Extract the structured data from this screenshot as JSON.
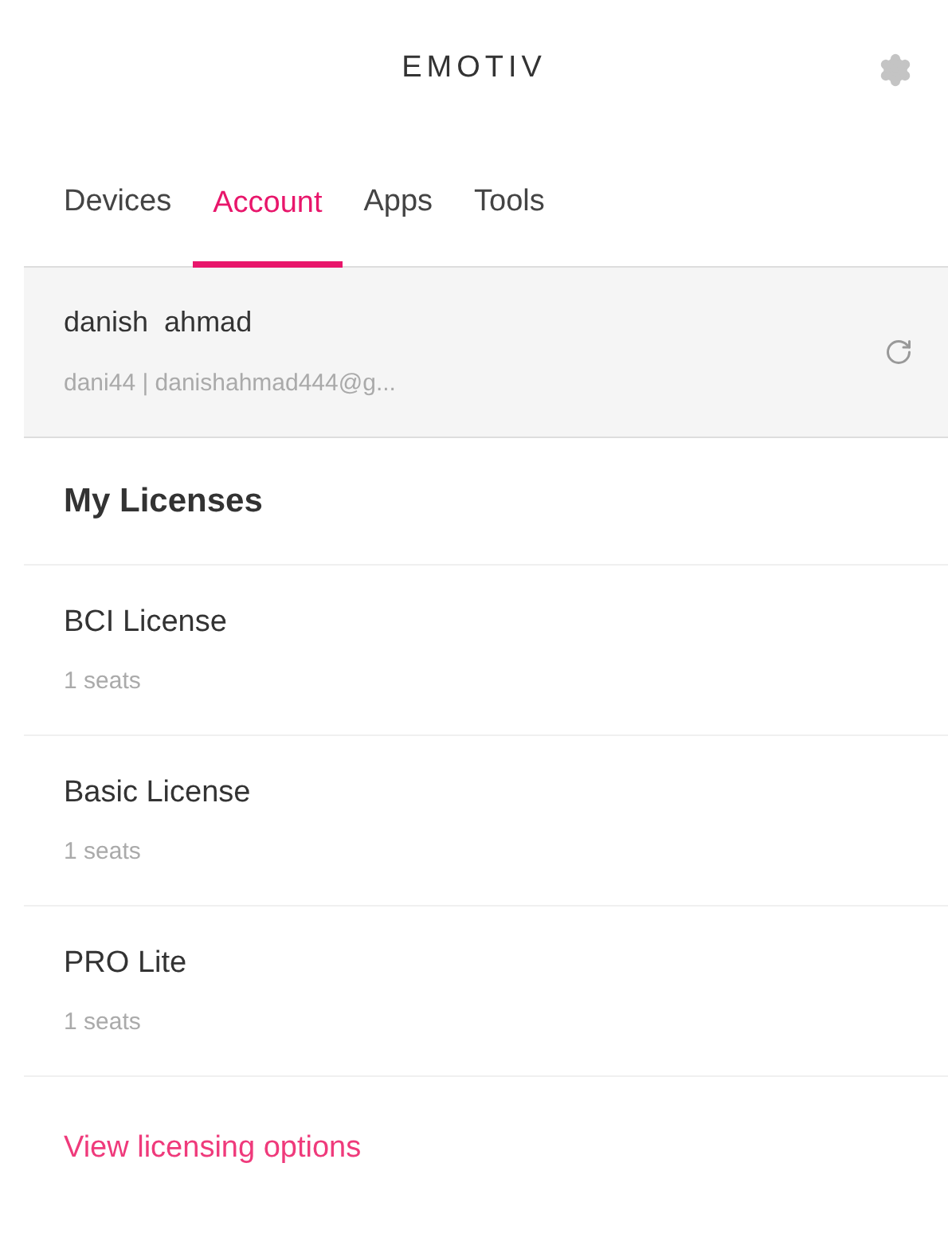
{
  "header": {
    "logo": "EMOTIV"
  },
  "tabs": [
    {
      "label": "Devices",
      "selected": false
    },
    {
      "label": "Account",
      "selected": true
    },
    {
      "label": "Apps",
      "selected": false
    },
    {
      "label": "Tools",
      "selected": false
    }
  ],
  "account": {
    "name": "danish  ahmad",
    "details": "dani44 | danishahmad444@g..."
  },
  "licenses": {
    "title": "My Licenses",
    "items": [
      {
        "name": "BCI License",
        "seats": "1 seats"
      },
      {
        "name": "Basic License",
        "seats": "1 seats"
      },
      {
        "name": "PRO Lite",
        "seats": "1 seats"
      }
    ]
  },
  "link": "View licensing options"
}
